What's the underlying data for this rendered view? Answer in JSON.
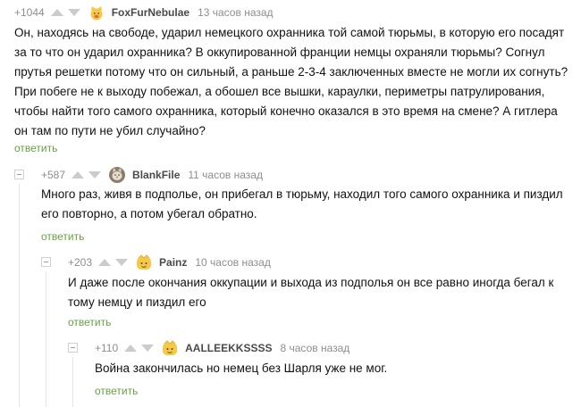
{
  "comments": [
    {
      "rating": "+1044",
      "username": "FoxFurNebulae",
      "time": "13 часов назад",
      "avatar_icon": "fox-avatar-icon",
      "lines": [
        "Он, находясь на свободе, ударил немецкого охранника той самой тюрьмы, в которую его посадят",
        "за то что он ударил охранника? В оккупированной франции немцы охраняли тюрьмы? Согнул",
        "прутья решетки потому что он сильный, а раньше 2-3-4 заключенных вместе не могли их согнуть?",
        "При побеге не к выходу побежал, а обошел все вышки, караулки, периметры патрулирования,",
        "чтобы найти того самого охранника, который конечно оказался в это время на смене? А гитлера",
        "он там по пути не убил случайно?"
      ],
      "reply_label": "ответить"
    },
    {
      "rating": "+587",
      "username": "BlankFile",
      "time": "11 часов назад",
      "avatar_icon": "cat-photo-avatar-icon",
      "lines": [
        "Много раз, живя в подполье, он прибегал в тюрьму, находил того самого охранника и пиздил",
        "его повторно, а потом убегал обратно."
      ],
      "reply_label": "ответить"
    },
    {
      "rating": "+203",
      "username": "Painz",
      "time": "10 часов назад",
      "avatar_icon": "default-avatar-icon",
      "lines": [
        "И даже после окончания оккупации и выхода из подполья он все равно иногда бегал к",
        "тому немцу и пиздил его"
      ],
      "reply_label": "ответить"
    },
    {
      "rating": "+110",
      "username": "AALLEEKKSSSS",
      "time": "8 часов назад",
      "avatar_icon": "default-avatar-icon",
      "lines": [
        "Война закончилась но немец без Шарля уже не мог."
      ],
      "reply_label": "ответить"
    }
  ],
  "colors": {
    "reply_link": "#6a9f44",
    "meta_text": "#8e8e8e",
    "username": "#4a4a4a",
    "body_text": "#111111",
    "vote_arrow": "#cbcbcb",
    "avatar_yellow": "#f5c84a"
  }
}
